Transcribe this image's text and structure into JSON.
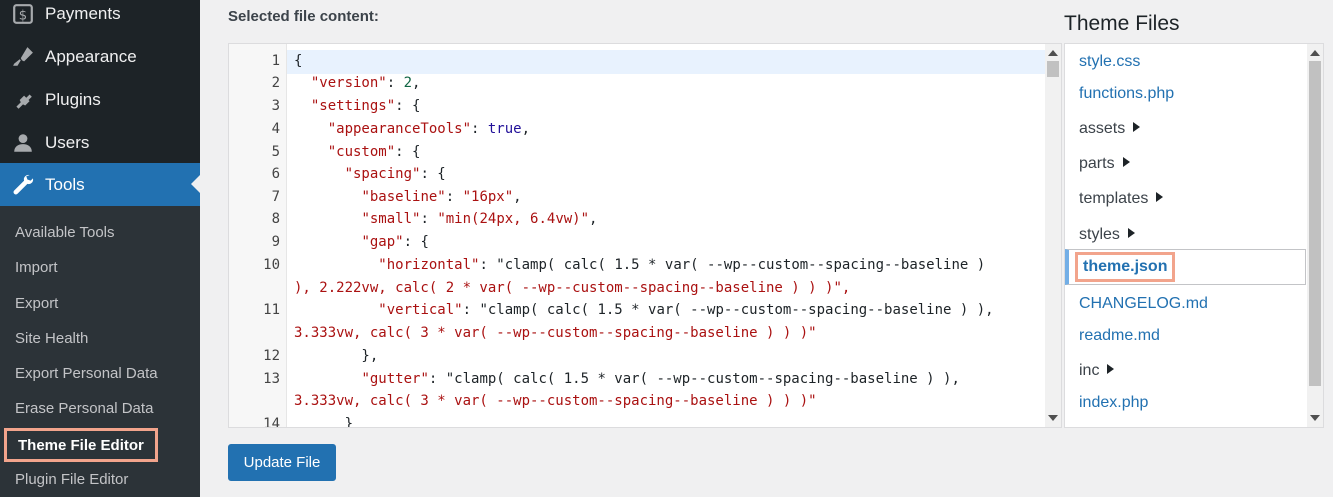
{
  "sidebar": {
    "menu": [
      {
        "label": "Payments",
        "icon": "payments-icon"
      },
      {
        "label": "Appearance",
        "icon": "appearance-icon"
      },
      {
        "label": "Plugins",
        "icon": "plugins-icon"
      },
      {
        "label": "Users",
        "icon": "users-icon"
      },
      {
        "label": "Tools",
        "icon": "tools-icon"
      }
    ],
    "submenu": [
      "Available Tools",
      "Import",
      "Export",
      "Site Health",
      "Export Personal Data",
      "Erase Personal Data",
      "Theme File Editor",
      "Plugin File Editor"
    ]
  },
  "editor": {
    "label": "Selected file content:",
    "line_numbers": [
      "1",
      "2",
      "3",
      "4",
      "5",
      "6",
      "7",
      "8",
      "9",
      "10",
      "11",
      "12",
      "13",
      "14"
    ],
    "lines": [
      "{",
      "  \"version\": 2,",
      "  \"settings\": {",
      "    \"appearanceTools\": true,",
      "    \"custom\": {",
      "      \"spacing\": {",
      "        \"baseline\": \"16px\",",
      "        \"small\": \"min(24px, 6.4vw)\",",
      "        \"gap\": {",
      "          \"horizontal\": \"clamp( calc( 1.5 * var( --wp--custom--spacing--baseline )",
      "), 2.222vw, calc( 2 * var( --wp--custom--spacing--baseline ) ) )\",",
      "          \"vertical\": \"clamp( calc( 1.5 * var( --wp--custom--spacing--baseline ) ),",
      "3.333vw, calc( 3 * var( --wp--custom--spacing--baseline ) ) )\"",
      "        },",
      "        \"gutter\": \"clamp( calc( 1.5 * var( --wp--custom--spacing--baseline ) ),",
      "3.333vw, calc( 3 * var( --wp--custom--spacing--baseline ) ) )\"",
      "      }"
    ],
    "update_button": "Update File"
  },
  "files": {
    "title": "Theme Files",
    "items": [
      {
        "label": "style.css",
        "type": "file"
      },
      {
        "label": "functions.php",
        "type": "file"
      },
      {
        "label": "assets",
        "type": "dir"
      },
      {
        "label": "parts",
        "type": "dir"
      },
      {
        "label": "templates",
        "type": "dir"
      },
      {
        "label": "styles",
        "type": "dir"
      },
      {
        "label": "theme.json",
        "type": "file",
        "selected": true
      },
      {
        "label": "CHANGELOG.md",
        "type": "file"
      },
      {
        "label": "readme.md",
        "type": "file"
      },
      {
        "label": "inc",
        "type": "dir"
      },
      {
        "label": "index.php",
        "type": "file"
      }
    ]
  },
  "colors": {
    "sidebar_bg": "#1d2327",
    "submenu_bg": "#2c3338",
    "accent": "#2271b1",
    "highlight_border": "#f2a48c"
  }
}
